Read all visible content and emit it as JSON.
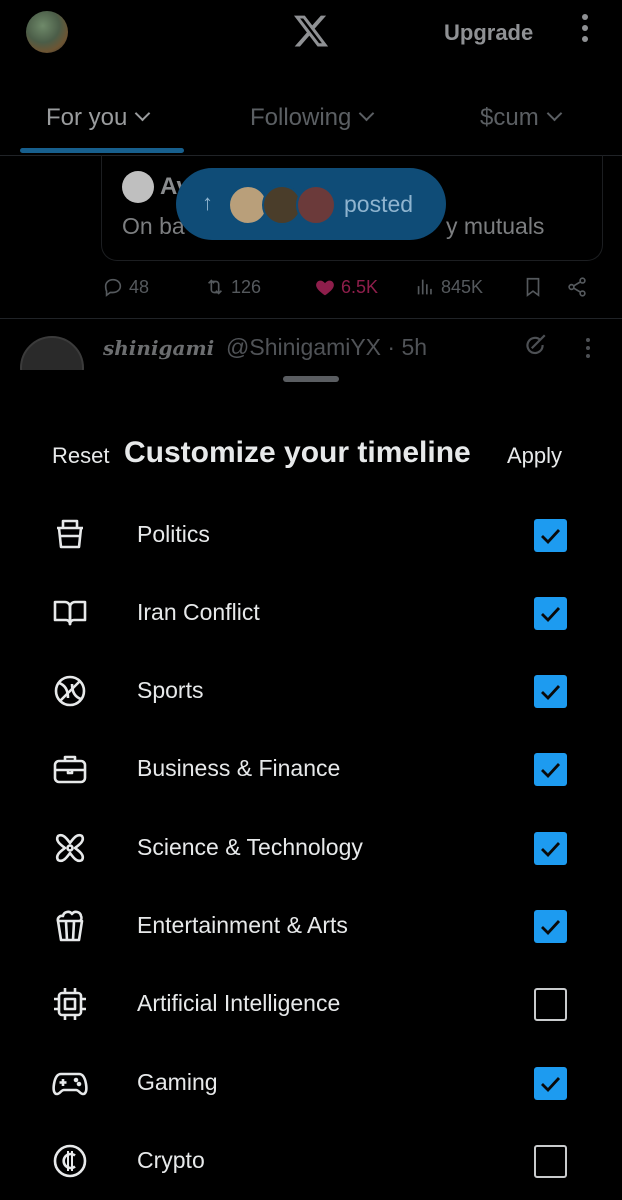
{
  "header": {
    "upgrade_label": "Upgrade"
  },
  "tabs": [
    {
      "label": "For you",
      "active": true
    },
    {
      "label": "Following",
      "active": false
    },
    {
      "label": "$cum",
      "active": false
    }
  ],
  "feed": {
    "quote": {
      "author_partial": "Av",
      "text_left": "On ba",
      "text_right": "y mutuals"
    },
    "posted_pill_label": "posted",
    "stats": {
      "replies": "48",
      "reposts": "126",
      "likes": "6.5K",
      "views": "845K"
    },
    "next_post": {
      "display_name": "shinigami",
      "handle_time": "@ShinigamiYX · 5h"
    }
  },
  "sheet": {
    "reset_label": "Reset",
    "title": "Customize your timeline",
    "apply_label": "Apply",
    "topics": [
      {
        "label": "Politics",
        "icon": "ballot-box-icon",
        "checked": true
      },
      {
        "label": "Iran Conflict",
        "icon": "open-book-icon",
        "checked": true
      },
      {
        "label": "Sports",
        "icon": "ball-icon",
        "checked": true
      },
      {
        "label": "Business & Finance",
        "icon": "briefcase-icon",
        "checked": true
      },
      {
        "label": "Science & Technology",
        "icon": "atom-icon",
        "checked": true
      },
      {
        "label": "Entertainment & Arts",
        "icon": "popcorn-icon",
        "checked": true
      },
      {
        "label": "Artificial Intelligence",
        "icon": "chip-icon",
        "checked": false
      },
      {
        "label": "Gaming",
        "icon": "gamepad-icon",
        "checked": true
      },
      {
        "label": "Crypto",
        "icon": "coin-icon",
        "checked": false
      }
    ]
  },
  "colors": {
    "accent": "#1d9bf0",
    "background": "#000000",
    "text": "#e7e9ea",
    "like": "#f91880"
  }
}
